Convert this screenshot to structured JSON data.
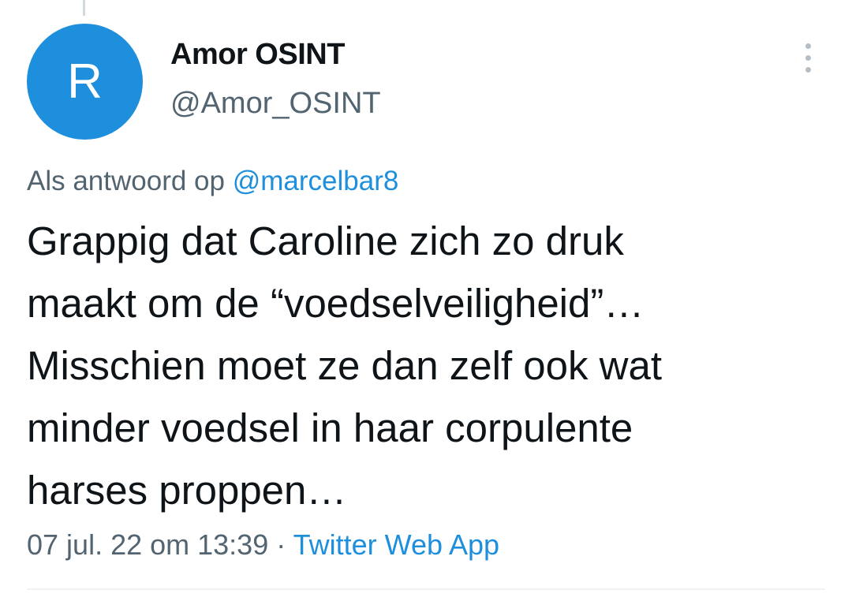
{
  "tweet": {
    "avatar_letter": "R",
    "display_name": "Amor OSINT",
    "handle": "@Amor_OSINT",
    "more_icon": "more-vertical-icon",
    "reply_prefix": "Als antwoord op",
    "reply_mention": "@marcelbar8",
    "text_lines": [
      "Grappig dat Caroline zich zo druk",
      "maakt om de “voedselveiligheid”…",
      "Misschien moet ze dan zelf ook wat",
      "minder voedsel in haar corpulente",
      "harses proppen…"
    ],
    "timestamp": "07 jul. 22 om 13:39",
    "separator": "·",
    "source": "Twitter Web App"
  },
  "colors": {
    "avatar_bg": "#1d8fdc",
    "link": "#1d8fdc",
    "secondary_text": "#536471",
    "primary_text": "#0f1419"
  }
}
